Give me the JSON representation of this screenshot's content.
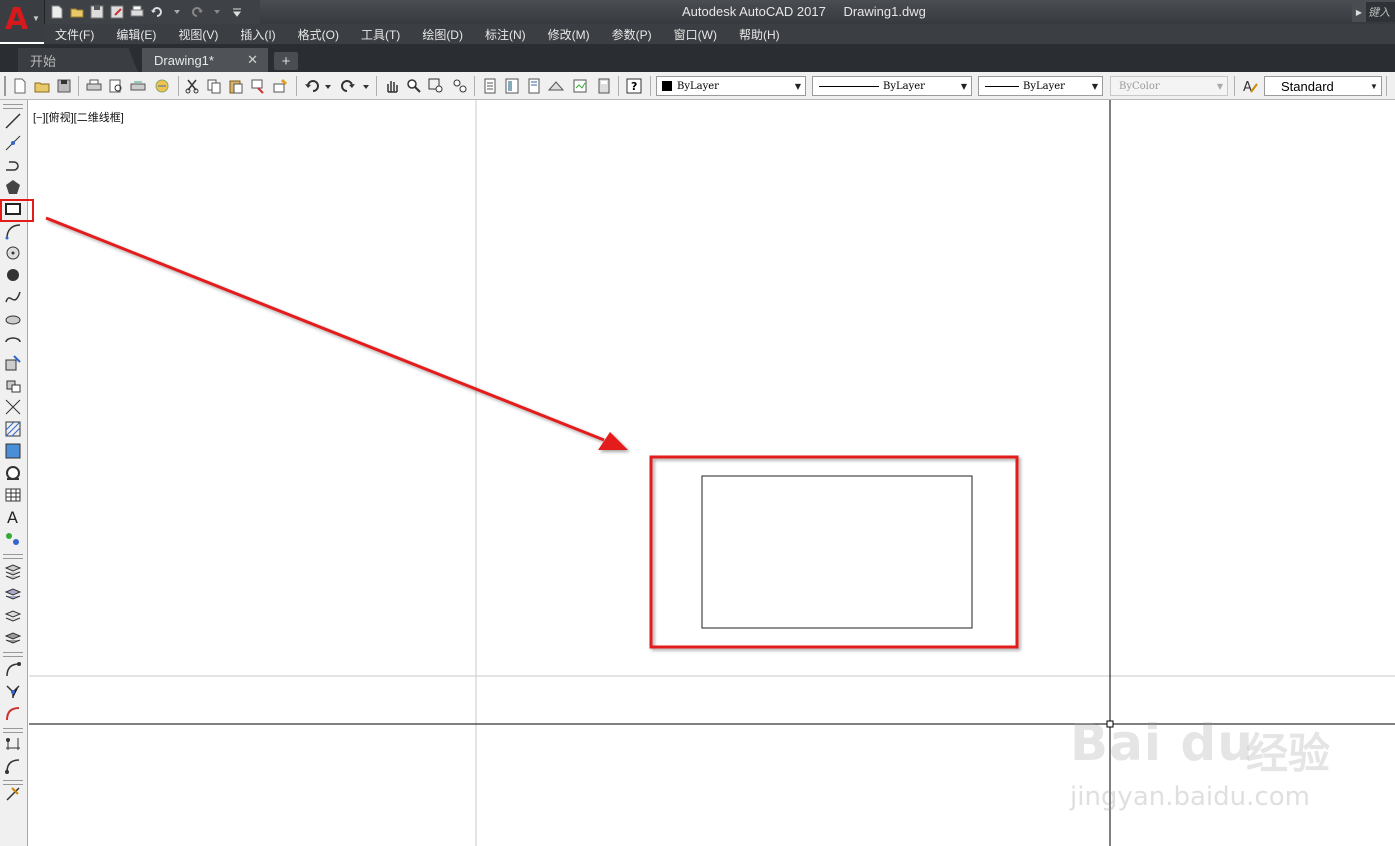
{
  "titlebar": {
    "app_name": "Autodesk AutoCAD 2017",
    "file_name": "Drawing1.dwg",
    "search_placeholder": "键入"
  },
  "menu": {
    "items": [
      "文件(F)",
      "编辑(E)",
      "视图(V)",
      "插入(I)",
      "格式(O)",
      "工具(T)",
      "绘图(D)",
      "标注(N)",
      "修改(M)",
      "参数(P)",
      "窗口(W)",
      "帮助(H)"
    ]
  },
  "tabs": {
    "start": "开始",
    "drawing": "Drawing1*",
    "close_glyph": "✕",
    "new_glyph": "+"
  },
  "properties": {
    "color": "ByLayer",
    "linetype": "ByLayer",
    "lineweight": "ByLayer",
    "plotstyle": "ByColor",
    "textstyle": "Standard"
  },
  "viewport": {
    "label": "[−][俯视][二维线框]"
  },
  "watermark": {
    "brand": "Bai  du",
    "jingyan": "经验",
    "url": "jingyan.baidu.com"
  },
  "colors": {
    "annotation_red": "#e31b1b",
    "logo_red": "#d7191c",
    "dark_chrome": "#3b3e42"
  }
}
